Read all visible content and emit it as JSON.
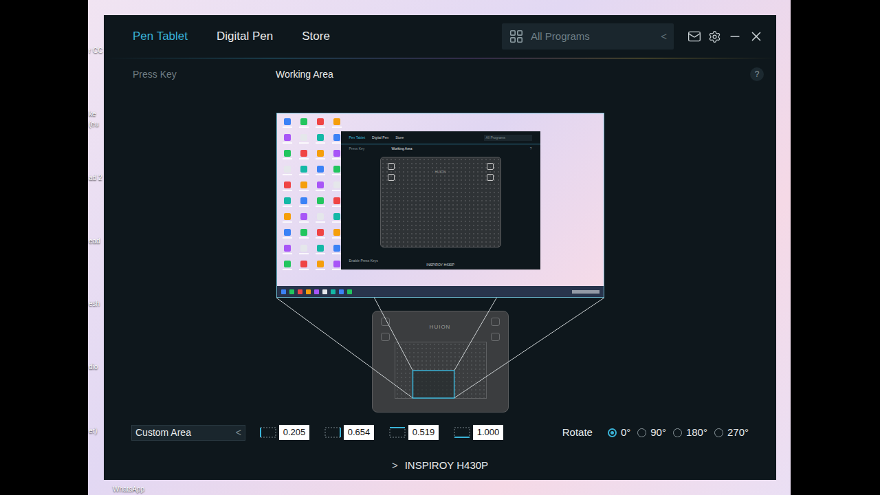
{
  "desktop": {
    "icon_labels": [
      "r CC",
      "ke",
      "(eu",
      "ad 2",
      "ead",
      "esh",
      "dio",
      "er)"
    ],
    "bottom_label": "WhatsApp"
  },
  "window": {
    "tabs": [
      {
        "label": "Pen Tablet",
        "selected": true
      },
      {
        "label": "Digital Pen",
        "selected": false
      },
      {
        "label": "Store",
        "selected": false
      }
    ],
    "program_selector": {
      "label": "All Programs",
      "chevron": "<"
    }
  },
  "subtabs": [
    {
      "label": "Press Key",
      "selected": false
    },
    {
      "label": "Working Area",
      "selected": true
    }
  ],
  "help": "?",
  "preview": {
    "tabs": [
      "Pen Tablet",
      "Digital Pen",
      "Store"
    ],
    "program": "All Programs",
    "subtabs": [
      "Press Key",
      "Working Area"
    ],
    "help": "?",
    "brand": "HUION",
    "checkbox_label": "Enable Press Keys",
    "device": "INSPIROY H430P"
  },
  "tablet": {
    "brand": "HUION"
  },
  "area": {
    "mode": {
      "label": "Custom Area",
      "chevron": "<"
    },
    "fields": [
      {
        "kind": "left",
        "value": "0.205"
      },
      {
        "kind": "right",
        "value": "0.654"
      },
      {
        "kind": "top",
        "value": "0.519"
      },
      {
        "kind": "bottom",
        "value": "1.000"
      }
    ]
  },
  "rotate": {
    "label": "Rotate",
    "options": [
      {
        "label": "0°",
        "selected": true
      },
      {
        "label": "90°",
        "selected": false
      },
      {
        "label": "180°",
        "selected": false
      },
      {
        "label": "270°",
        "selected": false
      }
    ]
  },
  "device": {
    "arrow": ">",
    "name": "INSPIROY H430P"
  }
}
